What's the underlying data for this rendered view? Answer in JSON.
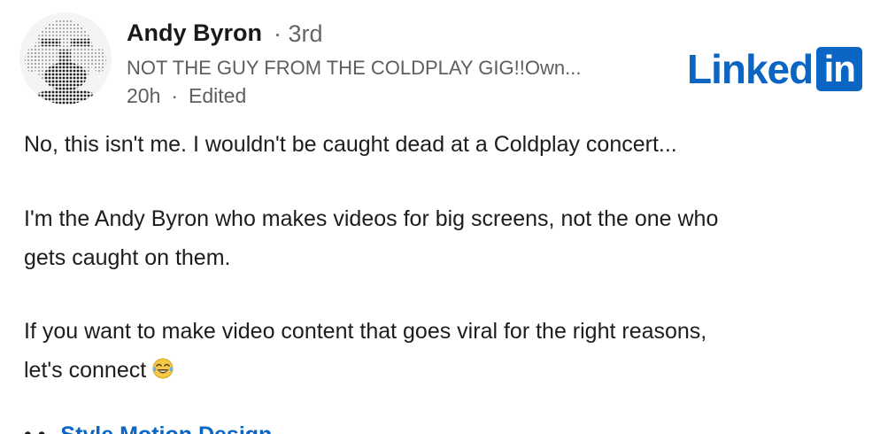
{
  "post": {
    "author": {
      "name": "Andy Byron",
      "degree": "· 3rd",
      "headline": "NOT THE GUY FROM THE COLDPLAY GIG!!Own...",
      "time": "20h",
      "separator": "·",
      "edited": "Edited"
    },
    "brand": {
      "word": "Linked",
      "box": "in",
      "color": "#0a66c2"
    },
    "paragraphs": [
      {
        "lines": [
          "No, this isn't me. I wouldn't be caught dead at a Coldplay concert..."
        ]
      },
      {
        "lines": [
          "I'm the Andy Byron who makes videos for big screens, not the one who",
          "gets caught on them."
        ]
      },
      {
        "lines": [
          "If you want to make video content that goes viral for the right reasons,",
          "let's connect"
        ],
        "emoji": "tears-of-joy-emoji"
      }
    ],
    "cutoff": {
      "mark": "• •",
      "link_text": "Style Motion Design"
    }
  }
}
